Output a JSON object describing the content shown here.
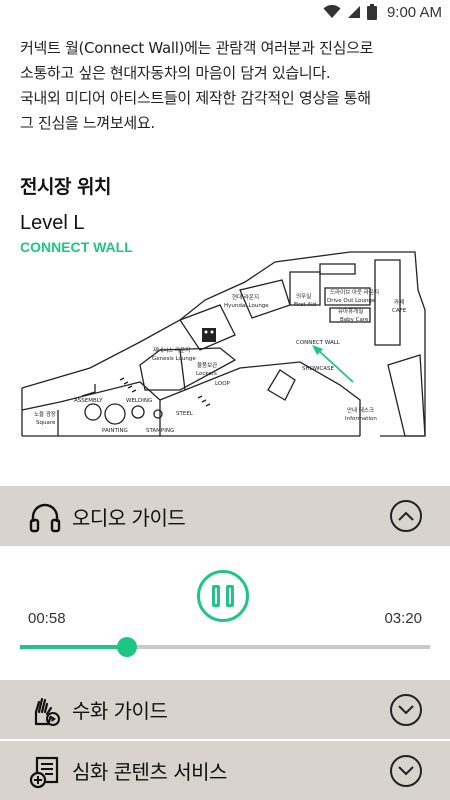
{
  "status_bar": {
    "time": "9:00 AM",
    "icons": [
      "wifi-icon",
      "signal-icon",
      "battery-icon"
    ]
  },
  "intro": {
    "lines": [
      "커넥트 월(Connect Wall)에는 관람객 여러분과 진심으로",
      "소통하고 싶은 현대자동차의 마음이 담겨 있습니다.",
      "국내외 미디어 아티스트들이 제작한 감각적인 영상을 통해",
      "그 진심을 느껴보세요."
    ]
  },
  "location": {
    "title": "전시장 위치",
    "level": "Level L",
    "wall_label": "CONNECT WALL"
  },
  "map": {
    "labels": {
      "hyundai_lounge_ko": "현대 라운지",
      "hyundai_lounge_en": "Hyundai Lounge",
      "first_aid_ko": "의무실",
      "first_aid_en": "First Aid",
      "drive_out_ko": "드라이브 아웃 라운지",
      "drive_out_en": "Drive Out Lounge",
      "baby_care_ko": "유아휴게실",
      "baby_care_en": "Baby Care",
      "cafe_ko": "카페",
      "cafe_en": "CAFE",
      "genesis_ko": "제네시스 라운지",
      "genesis_en": "Genesis Lounge",
      "connect_wall": "CONNECT WALL",
      "showcase": "SHOWCASE",
      "lockers_ko": "물품보관",
      "lockers_en": "Lockers",
      "loop": "LOOP",
      "square_ko": "노을 광장",
      "square_en": "Square",
      "assembly": "ASSEMBLY",
      "welding": "WELDING",
      "painting": "PAINTING",
      "stamping": "STAMPING",
      "steel": "STEEL",
      "info_ko": "안내 데스크",
      "info_en": "Information"
    }
  },
  "audio_guide": {
    "label": "오디오 가이드",
    "current_time": "00:58",
    "total_time": "03:20",
    "progress": 0.26,
    "state": "playing"
  },
  "sign_guide": {
    "label": "수화 가이드"
  },
  "deep_content": {
    "label": "심화 콘텐츠 서비스"
  },
  "colors": {
    "accent": "#1ec685",
    "bar_bg": "#d8d3cd",
    "track": "#c9c9c9"
  }
}
